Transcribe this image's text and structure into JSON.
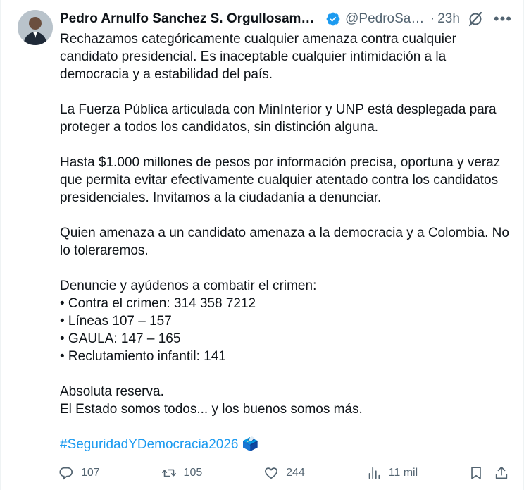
{
  "author": {
    "name": "Pedro Arnulfo Sanchez S. Orgullosamen...",
    "handle": "@PedroSan...",
    "separator": "·",
    "time": "23h"
  },
  "body": {
    "p1": "Rechazamos categóricamente cualquier amenaza contra cualquier candidato presidencial. Es inaceptable cualquier intimidación a la democracia y a estabilidad del país.",
    "p2": "La Fuerza Pública articulada con MinInterior y UNP está desplegada para proteger a todos los candidatos, sin distinción alguna.",
    "p3": "Hasta $1.000 millones de pesos por información precisa, oportuna y veraz que permita evitar efectivamente cualquier  atentado contra los candidatos presidenciales. Invitamos a la ciudadanía a denunciar.",
    "p4": "Quien amenaza a un candidato amenaza a la democracia y a Colombia. No lo toleraremos.",
    "p5_intro": "Denuncie y ayúdenos a combatir el crimen:",
    "list": [
      "• Contra el crimen: 314 358 7212",
      "• Líneas 107 – 157",
      "• GAULA: 147 – 165",
      "• Reclutamiento infantil: 141"
    ],
    "p6_line1": "Absoluta reserva.",
    "p6_line2": "El Estado somos todos... y los buenos somos más.",
    "hashtag": "#SeguridadYDemocracia2026",
    "emoji": "🗳️"
  },
  "actions": {
    "replies": "107",
    "reposts": "105",
    "likes": "244",
    "views": "11 mil"
  },
  "icons": [
    "verified-badge-icon",
    "grok-icon",
    "more-icon",
    "reply-icon",
    "repost-icon",
    "like-icon",
    "views-icon",
    "bookmark-icon",
    "share-icon"
  ],
  "colors": {
    "accent": "#1d9bf0",
    "secondary_text": "#536471",
    "text": "#0f1419"
  }
}
